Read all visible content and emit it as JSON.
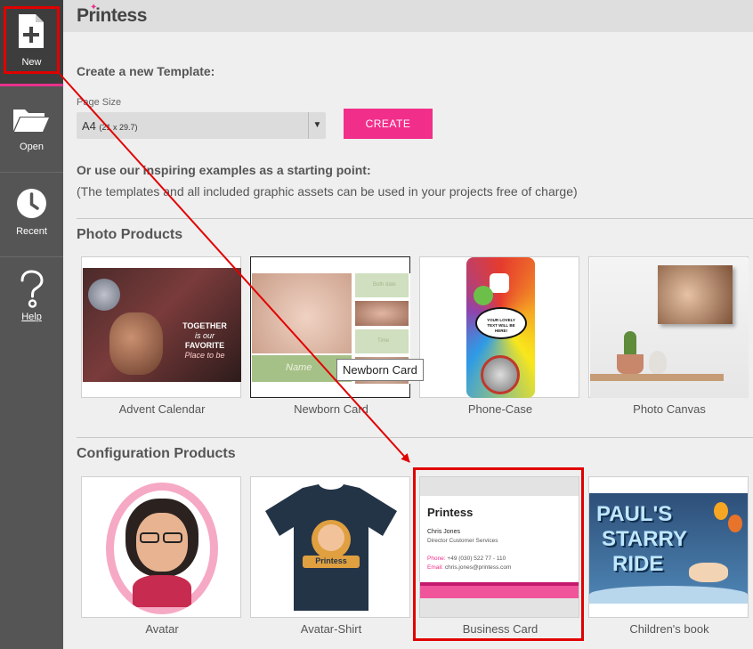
{
  "sidebar": {
    "items": [
      {
        "label": "New",
        "icon": "new-file-icon"
      },
      {
        "label": "Open",
        "icon": "folder-icon"
      },
      {
        "label": "Recent",
        "icon": "clock-icon"
      },
      {
        "label": "Help",
        "icon": "help-icon"
      }
    ]
  },
  "header": {
    "logo": "Printess"
  },
  "create": {
    "heading": "Create a new Template:",
    "page_size_label": "Page Size",
    "page_size_value": "A4",
    "page_size_dims": "(21 x 29.7)",
    "button": "CREATE"
  },
  "examples": {
    "heading": "Or use our inspiring examples as a starting point:",
    "note": "(The templates and all included graphic assets can be used in your projects free of charge)"
  },
  "photo_products": {
    "title": "Photo Products",
    "items": [
      "Advent Calendar",
      "Newborn Card",
      "Phone-Case",
      "Photo Canvas"
    ]
  },
  "config_products": {
    "title": "Configuration Products",
    "items": [
      "Avatar",
      "Avatar-Shirt",
      "Business Card",
      "Children's book"
    ]
  },
  "tooltip": "Newborn Card",
  "thumb_text": {
    "advent": [
      "TOGETHER",
      "is our",
      "FAVORITE",
      "Place to be"
    ],
    "newborn_name": "Name",
    "newborn_small": [
      "Both date",
      "Time"
    ],
    "phone_bubble": "YOUR LOVELY TEXT WILL BE HERE!",
    "shirt": "Printess",
    "biz_logo": "Printess",
    "biz_name": "Chris Jones",
    "biz_role": "Director Customer Services",
    "biz_phone_label": "Phone:",
    "biz_phone": "+49 (030) 522 77 - 110",
    "biz_email_label": "Email:",
    "biz_email": "chris.jones@printess.com",
    "book_lines": [
      "PAUL'S",
      "STARRY",
      "RIDE"
    ]
  },
  "colors": {
    "accent": "#f22e8b",
    "sidebar": "#555555",
    "highlight": "#e10000"
  }
}
